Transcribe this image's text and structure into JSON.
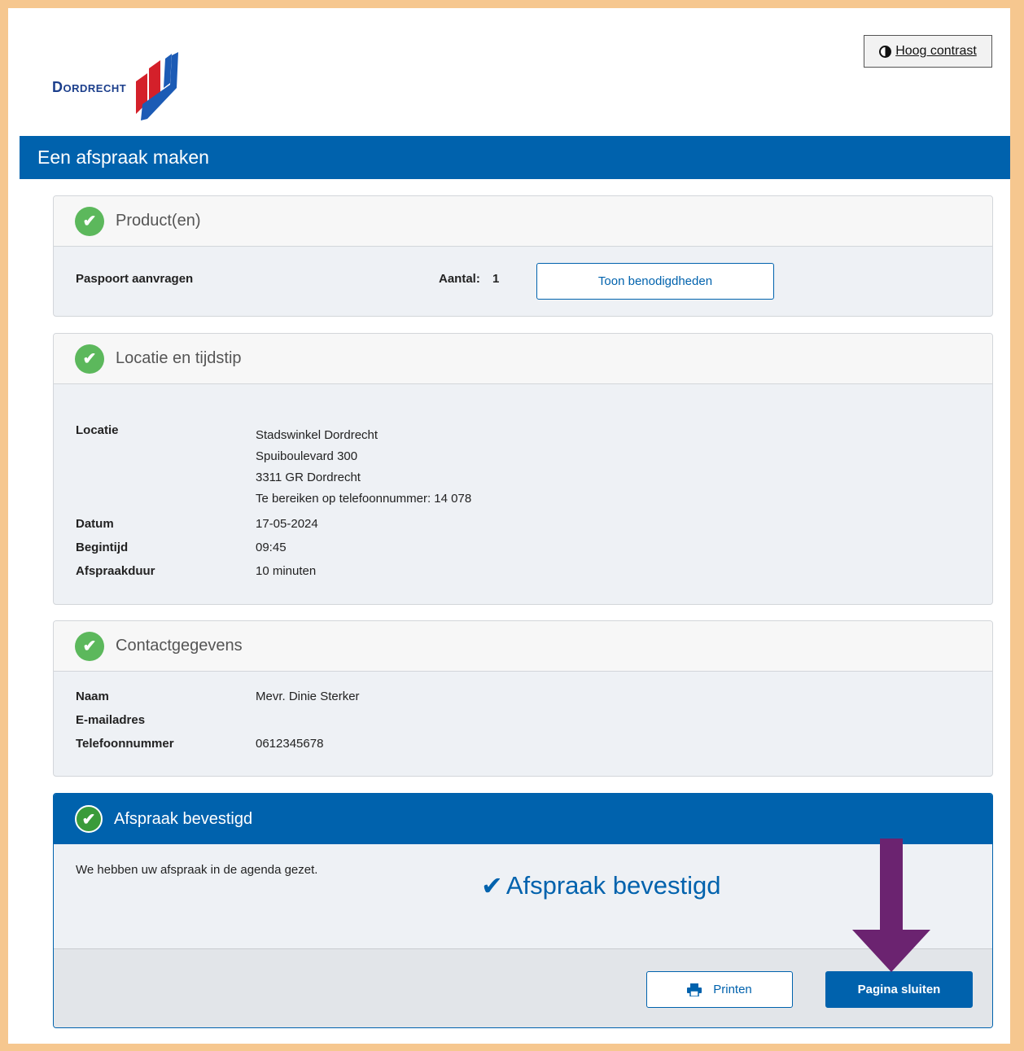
{
  "header": {
    "logo_text": "Dordrecht",
    "contrast_label": "Hoog contrast"
  },
  "title": "Een afspraak maken",
  "products": {
    "heading": "Product(en)",
    "name": "Paspoort aanvragen",
    "aantal_label": "Aantal:",
    "aantal_value": "1",
    "show_button": "Toon benodigdheden"
  },
  "location": {
    "heading": "Locatie en tijdstip",
    "locatie_label": "Locatie",
    "address_lines": [
      "Stadswinkel Dordrecht",
      "Spuiboulevard 300",
      "3311 GR Dordrecht",
      "Te bereiken op telefoonnummer: 14 078"
    ],
    "datum_label": "Datum",
    "datum_value": "17-05-2024",
    "begintijd_label": "Begintijd",
    "begintijd_value": "09:45",
    "duur_label": "Afspraakduur",
    "duur_value": "10 minuten"
  },
  "contact": {
    "heading": "Contactgegevens",
    "naam_label": "Naam",
    "naam_value": "Mevr. Dinie Sterker",
    "email_label": "E-mailadres",
    "email_value": "",
    "tel_label": "Telefoonnummer",
    "tel_value": "0612345678"
  },
  "confirmation": {
    "heading": "Afspraak bevestigd",
    "message": "We hebben uw afspraak in de agenda gezet.",
    "big_status": "Afspraak bevestigd",
    "print_button": "Printen",
    "close_button": "Pagina sluiten"
  },
  "colors": {
    "brand_blue": "#0062ad",
    "success_green": "#5cb85c",
    "arrow_purple": "#6b2370",
    "frame_orange": "#f6c78f"
  },
  "icons": [
    "contrast-icon",
    "check-circle-icon",
    "checkmark-icon",
    "printer-icon",
    "arrow-down-icon"
  ]
}
